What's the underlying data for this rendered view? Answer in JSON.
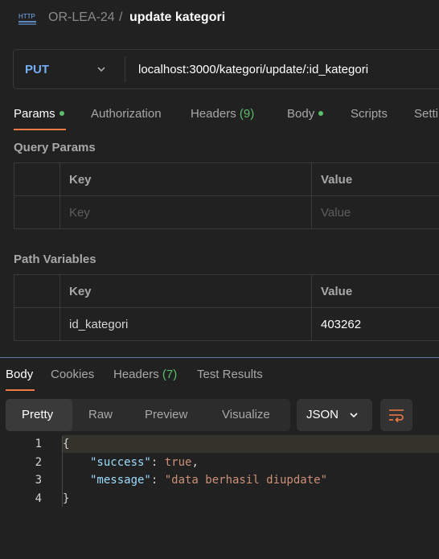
{
  "header": {
    "icon": "http-icon",
    "icon_text": "HTTP",
    "collection": "OR-LEA-24",
    "separator": "/",
    "title": "update kategori"
  },
  "request": {
    "method": "PUT",
    "method_color": "#74aef6",
    "url": "localhost:3000/kategori/update/:id_kategori"
  },
  "request_tabs": {
    "params": "Params",
    "authorization": "Authorization",
    "headers": "Headers",
    "headers_count": "(9)",
    "body": "Body",
    "scripts": "Scripts",
    "settings": "Settings"
  },
  "query_params": {
    "title": "Query Params",
    "key_header": "Key",
    "value_header": "Value",
    "key_placeholder": "Key",
    "value_placeholder": "Value"
  },
  "path_variables": {
    "title": "Path Variables",
    "key_header": "Key",
    "value_header": "Value",
    "rows": [
      {
        "key": "id_kategori",
        "value": "403262"
      }
    ]
  },
  "response_tabs": {
    "body": "Body",
    "cookies": "Cookies",
    "headers": "Headers",
    "headers_count": "(7)",
    "test_results": "Test Results"
  },
  "view_modes": {
    "pretty": "Pretty",
    "raw": "Raw",
    "preview": "Preview",
    "visualize": "Visualize",
    "format": "JSON"
  },
  "response_body": {
    "line_numbers": [
      "1",
      "2",
      "3",
      "4"
    ],
    "open_brace": "{",
    "close_brace": "}",
    "success_key": "\"success\"",
    "success_value": "true",
    "message_key": "\"message\"",
    "message_value": "\"data berhasil diupdate\""
  },
  "colors": {
    "accent": "#ef7a45",
    "status_green": "#5bbf6a",
    "json_key": "#9cdcfe",
    "json_string": "#ce9178"
  }
}
